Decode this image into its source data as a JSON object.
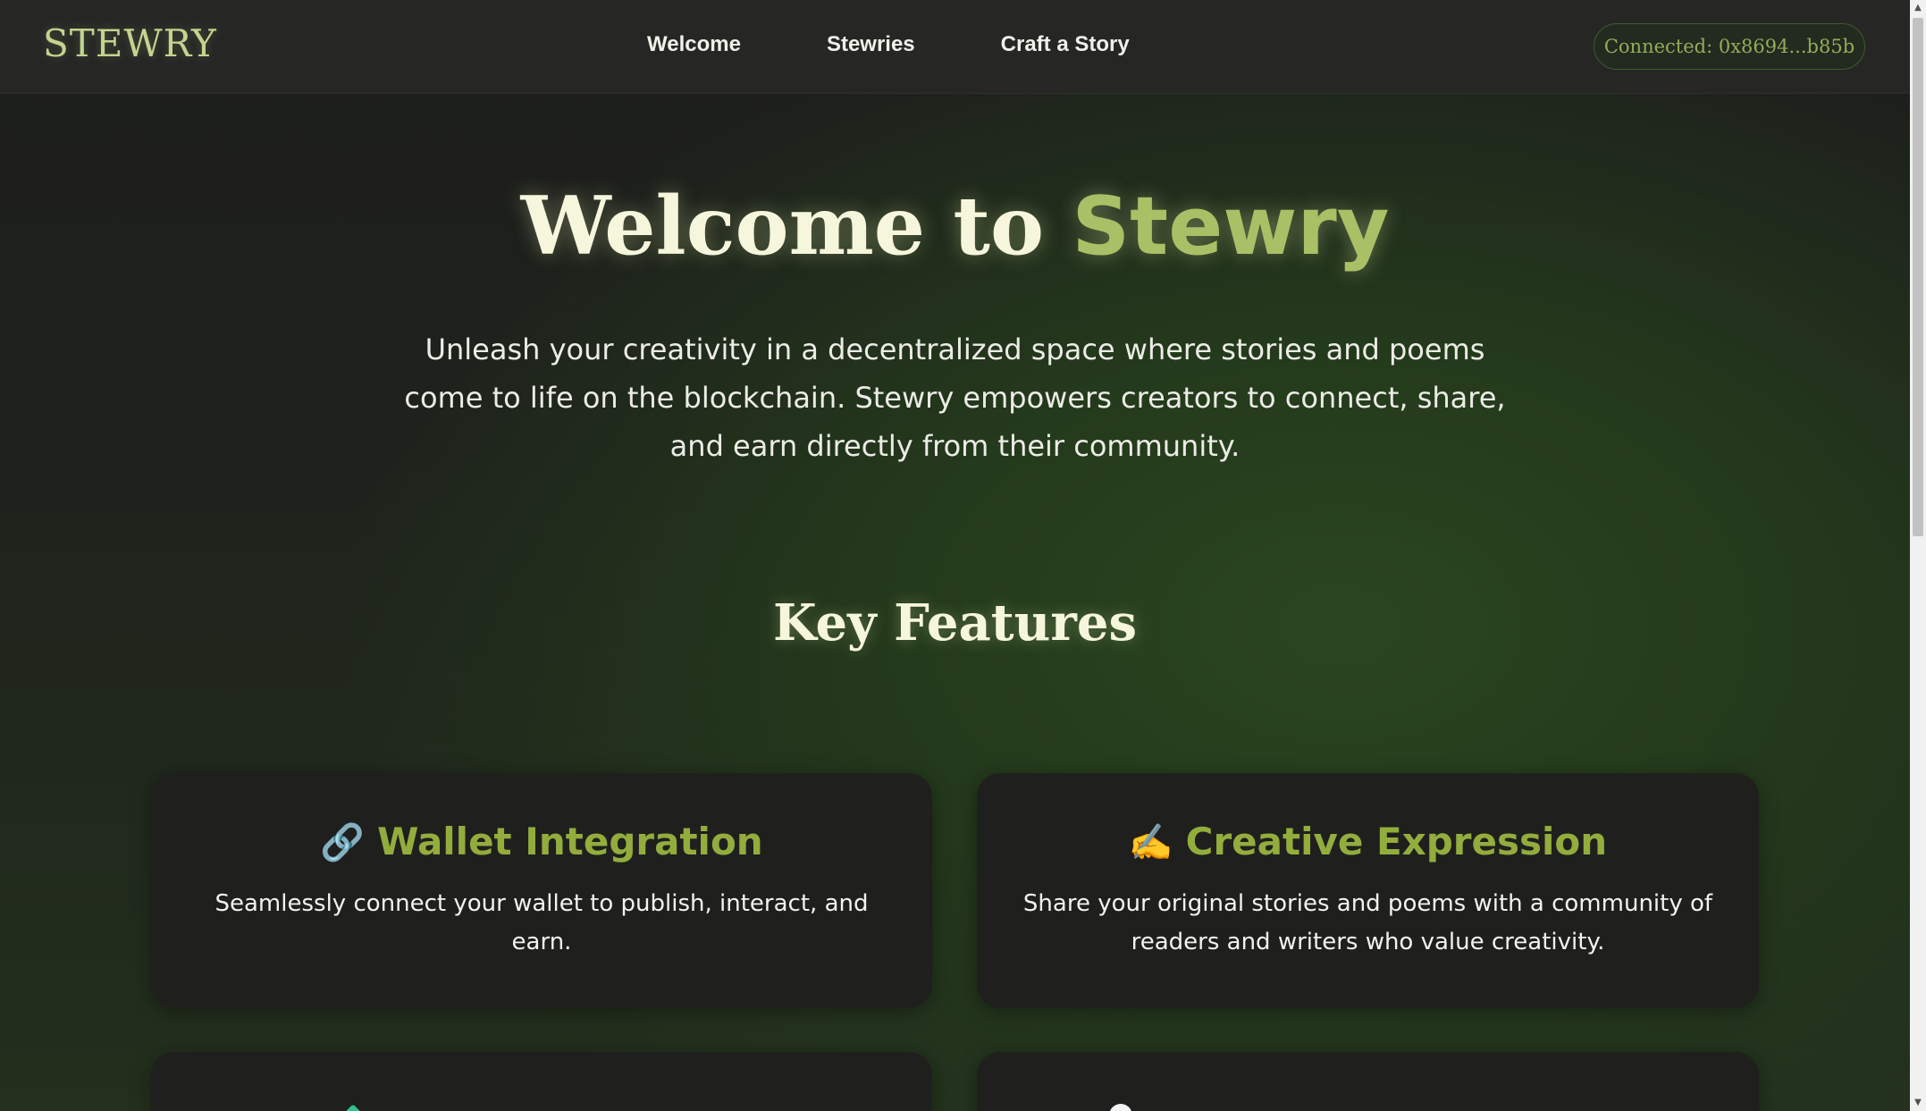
{
  "navbar": {
    "brand": "STEWRY",
    "links": [
      "Welcome",
      "Stewries",
      "Craft a Story"
    ],
    "wallet_status": "Connected: 0x8694...b85b"
  },
  "hero": {
    "title_prefix": "Welcome to",
    "title_accent": "Stewry",
    "description": "Unleash your creativity in a decentralized space where stories and poems come to life on the blockchain. Stewry empowers creators to connect, share, and earn directly from their community."
  },
  "features": {
    "heading": "Key Features",
    "cards": [
      {
        "icon": "link-icon",
        "emoji": "🔗",
        "title": "Wallet Integration",
        "description": "Seamlessly connect your wallet to publish, interact, and earn."
      },
      {
        "icon": "writing-hand-icon",
        "emoji": "✍️",
        "title": "Creative Expression",
        "description": "Share your original stories and poems with a community of readers and writers who value creativity."
      }
    ]
  },
  "colors": {
    "accent": "#a9c066",
    "card_title": "#93ad3d",
    "navbar_bg": "#262725",
    "card_bg": "#1f201e"
  }
}
